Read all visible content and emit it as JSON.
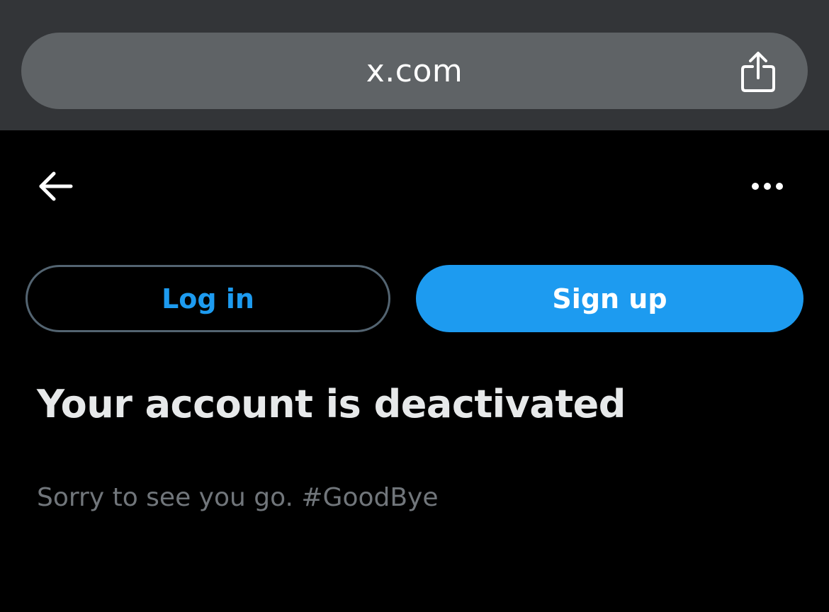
{
  "browser": {
    "url": "x.com",
    "share_icon": "share-icon"
  },
  "header": {
    "back_icon": "arrow-left-icon",
    "more_icon": "more-horizontal-icon"
  },
  "actions": {
    "login_label": "Log in",
    "signup_label": "Sign up"
  },
  "content": {
    "title": "Your account is deactivated",
    "message": "Sorry to see you go. #GoodBye"
  },
  "colors": {
    "accent": "#1d9bf0",
    "background": "#000000",
    "title_text": "#e7e9ea",
    "secondary_text": "#71767b",
    "browser_bar": "#333538",
    "url_pill": "#5f6366",
    "outline": "#536471"
  }
}
